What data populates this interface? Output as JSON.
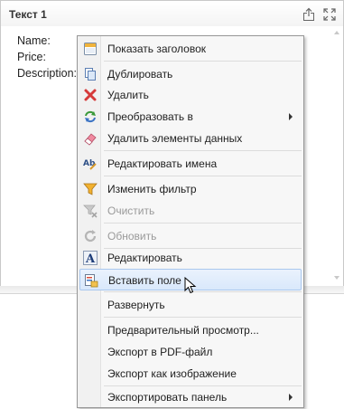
{
  "panel": {
    "title": "Текст 1",
    "lines": [
      "Name:",
      "Price:",
      "Description:"
    ],
    "export_icon": "export-icon",
    "maximize_icon": "maximize-icon"
  },
  "menu": {
    "items": [
      {
        "label": "Показать заголовок",
        "icon": "window-icon",
        "disabled": false
      },
      {
        "label": "Дублировать",
        "icon": "duplicate-icon",
        "disabled": false
      },
      {
        "label": "Удалить",
        "icon": "delete-icon",
        "disabled": false
      },
      {
        "label": "Преобразовать в",
        "icon": "convert-icon",
        "disabled": false,
        "submenu": true
      },
      {
        "label": "Удалить элементы данных",
        "icon": "eraser-icon",
        "disabled": false
      },
      {
        "label": "Редактировать имена",
        "icon": "rename-icon",
        "disabled": false
      },
      {
        "label": "Изменить фильтр",
        "icon": "filter-icon",
        "disabled": false
      },
      {
        "label": "Очистить",
        "icon": "clear-filter-icon",
        "disabled": true
      },
      {
        "label": "Обновить",
        "icon": "refresh-icon",
        "disabled": true
      },
      {
        "label": "Редактировать",
        "icon": "edit-text-icon",
        "disabled": false
      },
      {
        "label": "Вставить поле",
        "icon": "insert-field-icon",
        "disabled": false,
        "highlighted": true
      },
      {
        "label": "Развернуть",
        "icon": "",
        "disabled": false
      },
      {
        "label": "Предварительный просмотр...",
        "icon": "",
        "disabled": false
      },
      {
        "label": "Экспорт в PDF-файл",
        "icon": "",
        "disabled": false
      },
      {
        "label": "Экспорт как изображение",
        "icon": "",
        "disabled": false
      },
      {
        "label": "Экспортировать панель",
        "icon": "",
        "disabled": false,
        "submenu": true
      }
    ]
  },
  "colors": {
    "hover_bg": "#d9e8fb",
    "hover_border": "#a9c7ee",
    "disabled_text": "#9a9a9a"
  }
}
